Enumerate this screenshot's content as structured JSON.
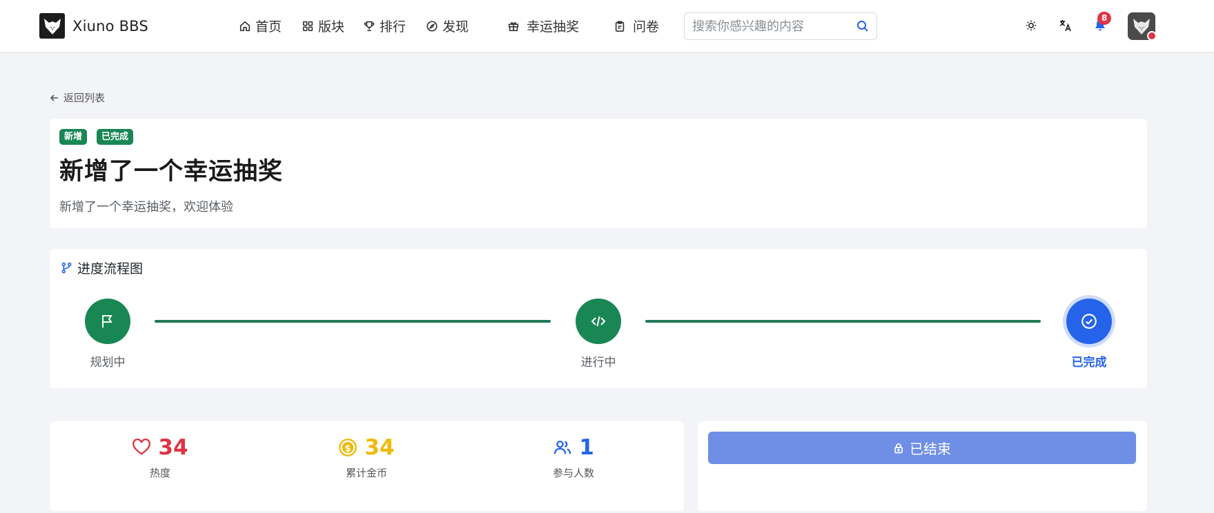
{
  "brand": {
    "name": "Xiuno BBS"
  },
  "nav": {
    "items": [
      {
        "label": "首页",
        "icon": "home-icon"
      },
      {
        "label": "版块",
        "icon": "grid-icon"
      },
      {
        "label": "排行",
        "icon": "trophy-icon"
      },
      {
        "label": "发现",
        "icon": "compass-icon"
      },
      {
        "label": "幸运抽奖",
        "icon": "gift-icon"
      },
      {
        "label": "问卷",
        "icon": "clipboard-icon"
      }
    ]
  },
  "search": {
    "placeholder": "搜索你感兴趣的内容"
  },
  "notifications": {
    "count": "8"
  },
  "back_link": "返回列表",
  "post": {
    "badges": [
      "新增",
      "已完成"
    ],
    "title": "新增了一个幸运抽奖",
    "subtitle": "新增了一个幸运抽奖，欢迎体验"
  },
  "progress": {
    "header": "进度流程图",
    "steps": [
      {
        "label": "规划中",
        "icon": "flag-icon",
        "status": "done"
      },
      {
        "label": "进行中",
        "icon": "code-icon",
        "status": "done"
      },
      {
        "label": "已完成",
        "icon": "check-circle-icon",
        "status": "current"
      }
    ]
  },
  "stats": [
    {
      "value": "34",
      "label": "热度",
      "icon": "heart-icon",
      "color": "#dc3545"
    },
    {
      "value": "34",
      "label": "累计金币",
      "icon": "coin-icon",
      "color": "#f0b90b"
    },
    {
      "value": "1",
      "label": "参与人数",
      "icon": "users-icon",
      "color": "#2563eb"
    }
  ],
  "action": {
    "ended_label": "已结束"
  },
  "colors": {
    "success": "#198754",
    "primary": "#2563eb",
    "danger": "#dc3545",
    "warning": "#f0b90b",
    "button_disabled": "#6f8fe6"
  }
}
